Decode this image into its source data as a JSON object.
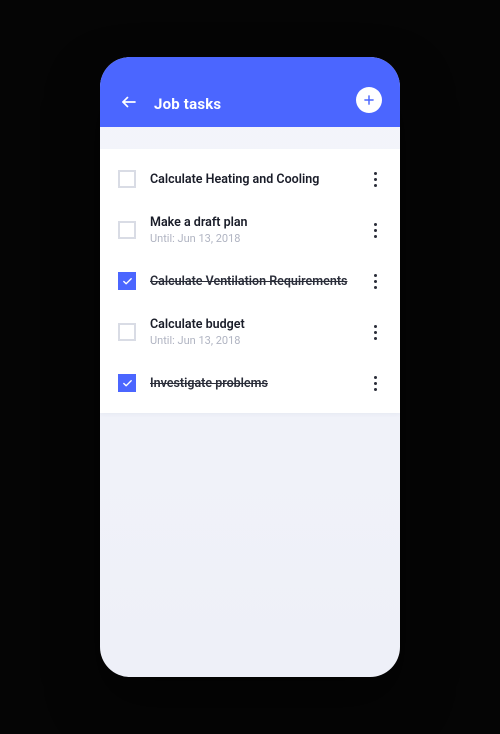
{
  "colors": {
    "accent": "#4b66ff"
  },
  "header": {
    "title": "Job tasks",
    "back_icon": "arrow-left",
    "add_icon": "plus"
  },
  "tasks": [
    {
      "label": "Calculate Heating and Cooling",
      "subtitle": "",
      "completed": false
    },
    {
      "label": "Make a draft plan",
      "subtitle": "Until: Jun 13, 2018",
      "completed": false
    },
    {
      "label": "Calculate Ventilation Requirements",
      "subtitle": "",
      "completed": true
    },
    {
      "label": "Calculate budget",
      "subtitle": "Until: Jun 13, 2018",
      "completed": false
    },
    {
      "label": "Investigate problems",
      "subtitle": "",
      "completed": true
    }
  ]
}
